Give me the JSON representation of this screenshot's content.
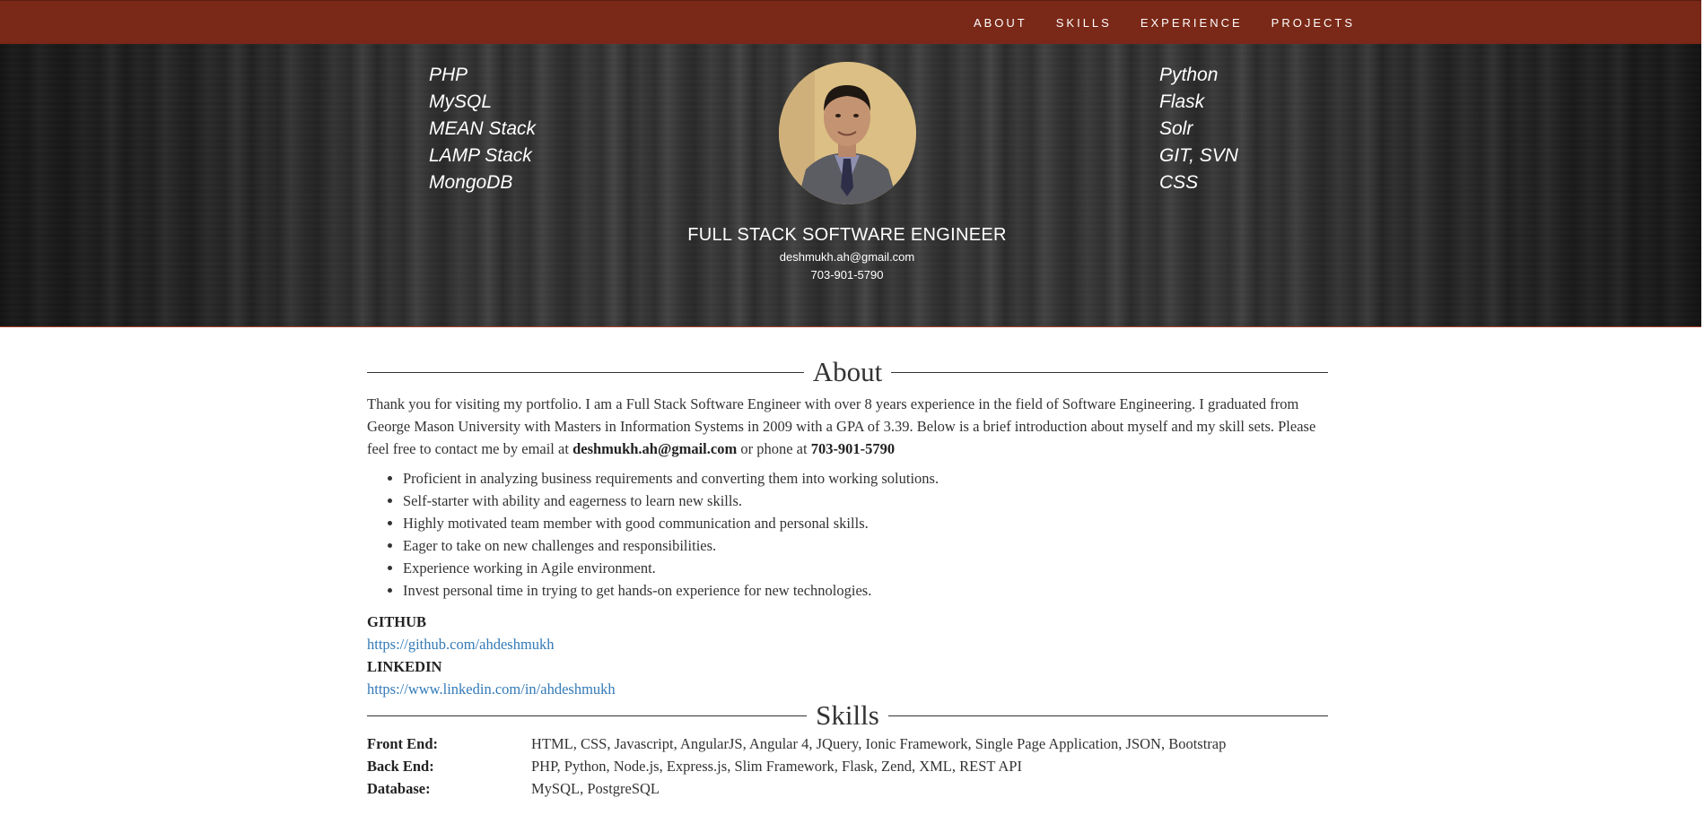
{
  "nav": {
    "items": [
      {
        "label": "ABOUT"
      },
      {
        "label": "SKILLS"
      },
      {
        "label": "EXPERIENCE"
      },
      {
        "label": "PROJECTS"
      }
    ]
  },
  "hero": {
    "left_skills": [
      "PHP",
      "MySQL",
      "MEAN Stack",
      "LAMP Stack",
      "MongoDB"
    ],
    "right_skills": [
      "Python",
      "Flask",
      "Solr",
      "GIT, SVN",
      "CSS"
    ],
    "title": "FULL STACK SOFTWARE ENGINEER",
    "email": "deshmukh.ah@gmail.com",
    "phone": "703-901-5790"
  },
  "about": {
    "heading": "About",
    "intro": "Thank you for visiting my portfolio. I am a Full Stack Software Engineer with over 8 years experience in the field of Software Engineering. I graduated from George Mason University with Masters in Information Systems in 2009 with a GPA of 3.39. Below is a brief introduction about myself and my skill sets. Please feel free to contact me by email at ",
    "intro_email": "deshmukh.ah@gmail.com",
    "intro_mid": " or phone at ",
    "intro_phone": "703-901-5790",
    "bullets": [
      "Proficient in analyzing business requirements and converting them into working solutions.",
      "Self-starter with ability and eagerness to learn new skills.",
      "Highly motivated team member with good communication and personal skills.",
      "Eager to take on new challenges and responsibilities.",
      "Experience working in Agile environment.",
      "Invest personal time in trying to get hands-on experience for new technologies."
    ],
    "github_label": "GITHUB",
    "github_url": "https://github.com/ahdeshmukh",
    "linkedin_label": "LINKEDIN",
    "linkedin_url": "https://www.linkedin.com/in/ahdeshmukh"
  },
  "skills": {
    "heading": "Skills",
    "rows": [
      {
        "label": "Front End:",
        "value": "HTML, CSS, Javascript, AngularJS, Angular 4, JQuery, Ionic Framework, Single Page Application, JSON, Bootstrap"
      },
      {
        "label": "Back End:",
        "value": "PHP, Python, Node.js, Express.js, Slim Framework, Flask, Zend, XML, REST API"
      },
      {
        "label": "Database:",
        "value": "MySQL, PostgreSQL"
      }
    ]
  },
  "colors": {
    "navbar": "#7a2817",
    "link": "#337ab7"
  }
}
